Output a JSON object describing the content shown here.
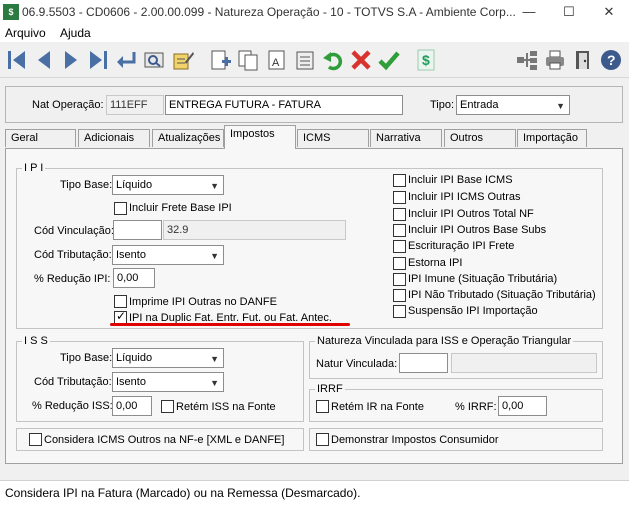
{
  "window": {
    "title": "06.9.5503 - CD0606 - 2.00.00.099 - Natureza Operação - 10 - TOTVS S.A - Ambiente Corp...",
    "app_icon": "$",
    "minimize": "—",
    "maximize": "☐",
    "close": "✕"
  },
  "menu": {
    "items": [
      "Arquivo",
      "Ajuda"
    ]
  },
  "toolbar": {
    "icons": [
      "first-icon",
      "prev-icon",
      "next-icon",
      "last-icon",
      "return-icon",
      "preview-icon",
      "edit-form-icon",
      "new-icon",
      "copy-icon",
      "text-icon",
      "list-icon",
      "delete-icon",
      "undo-icon",
      "cancel-icon",
      "confirm-icon",
      "money-icon",
      "hierarchy-icon",
      "print-icon",
      "exit-icon",
      "help-icon"
    ],
    "colors": {
      "nav": "#4a6fa5",
      "undo": "#2f9e3a",
      "cancel": "#d8322f",
      "confirm": "#2f9e3a",
      "money": "#1e9e5a",
      "help": "#3c5a8c"
    }
  },
  "header": {
    "nat_label": "Nat Operação:",
    "nat_code": "111EFF",
    "nat_desc": "ENTREGA FUTURA - FATURA",
    "tipo_label": "Tipo:",
    "tipo_value": "Entrada"
  },
  "tabs": [
    "Geral",
    "Adicionais",
    "Atualizações",
    "Impostos",
    "ICMS",
    "Narrativa",
    "Outros",
    "Importação"
  ],
  "active_tab": "Impostos",
  "ipi": {
    "legend": "I P I",
    "tipo_base_label": "Tipo Base:",
    "tipo_base_value": "Líquido",
    "frete_label": "Incluir Frete Base IPI",
    "cod_vinc_label": "Cód Vinculação:",
    "cod_vinc_value": "",
    "cod_vinc_desc": "32.9",
    "cod_trib_label": "Cód Tributação:",
    "cod_trib_value": "Isento",
    "reducao_label": "% Redução IPI:",
    "reducao_value": "0,00",
    "imprime_label": "Imprime IPI Outras no DANFE",
    "duplic_label": "IPI na Duplic Fat. Entr. Fut. ou Fat. Antec.",
    "right_checks": [
      "Incluir IPI Base ICMS",
      "Incluir IPI ICMS Outras",
      "Incluir IPI Outros Total NF",
      "Incluir IPI Outros Base Subs",
      "Escrituração IPI Frete",
      "Estorna IPI",
      "IPI Imune (Situação Tributária)",
      "IPI Não Tributado (Situação Tributária)",
      "Suspensão IPI Importação"
    ]
  },
  "iss": {
    "legend": "I S S",
    "tipo_base_label": "Tipo Base:",
    "tipo_base_value": "Líquido",
    "cod_trib_label": "Cód Tributação:",
    "cod_trib_value": "Isento",
    "reducao_label": "% Redução ISS:",
    "reducao_value": "0,00",
    "retem_label": "Retém ISS na Fonte"
  },
  "natureza_vinc": {
    "legend": "Natureza Vinculada para ISS e Operação Triangular",
    "label": "Natur Vinculada:",
    "value": "",
    "desc": ""
  },
  "irrf": {
    "legend": "IRRF",
    "retem_label": "Retém IR na Fonte",
    "irrf_label": "% IRRF:",
    "irrf_value": "0,00"
  },
  "bottom_checks": {
    "considera": "Considera ICMS Outros na NF-e [XML e DANFE]",
    "demonstrar": "Demonstrar Impostos Consumidor"
  },
  "status": {
    "text": "Considera IPI na Fatura (Marcado) ou na Remessa (Desmarcado)."
  },
  "highlight_color": "#e00000"
}
